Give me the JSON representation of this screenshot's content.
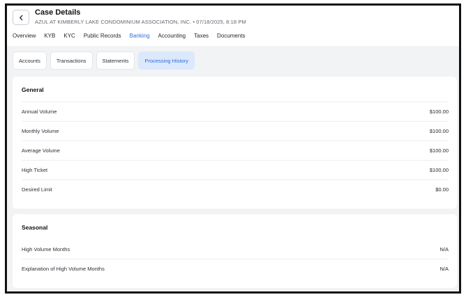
{
  "header": {
    "title": "Case Details",
    "subtitle": "AZUL AT KIMBERLY LAKE CONDOMINIUM ASSOCIATION, INC. • 07/18/2025, 8:18 PM"
  },
  "tabs": [
    "Overview",
    "KYB",
    "KYC",
    "Public Records",
    "Banking",
    "Accounting",
    "Taxes",
    "Documents"
  ],
  "active_tab": "Banking",
  "subtabs": [
    "Accounts",
    "Transactions",
    "Statements",
    "Processing History"
  ],
  "active_subtab": "Processing History",
  "general": {
    "title": "General",
    "rows": [
      {
        "label": "Annual Volume",
        "value": "$100.00"
      },
      {
        "label": "Monthly Volume",
        "value": "$100.00"
      },
      {
        "label": "Average Volume",
        "value": "$100.00"
      },
      {
        "label": "High Ticket",
        "value": "$100.00"
      },
      {
        "label": "Desired Limit",
        "value": "$0.00"
      }
    ]
  },
  "seasonal": {
    "title": "Seasonal",
    "rows": [
      {
        "label": "High Volume Months",
        "value": "N/A"
      },
      {
        "label": "Explanation of High Volume Months",
        "value": "N/A"
      }
    ]
  },
  "colors": {
    "accent": "#2f6fd8",
    "active_subtab_bg": "#dce8fb",
    "content_bg": "#f2f3f5"
  },
  "icons": {
    "back": "chevron-left-icon"
  }
}
